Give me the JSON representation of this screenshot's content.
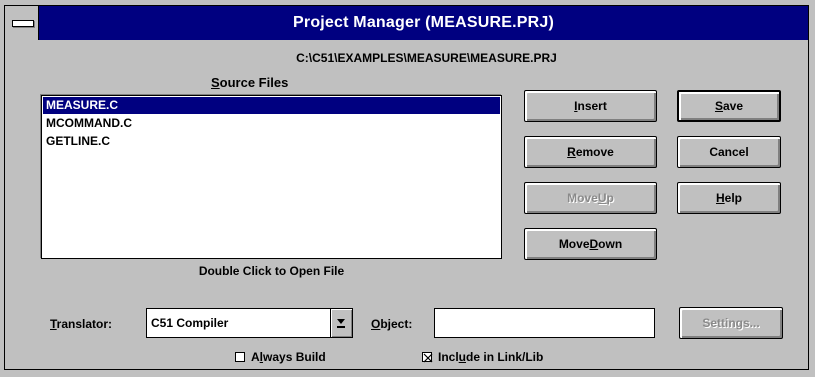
{
  "window": {
    "title": "Project Manager (MEASURE.PRJ)",
    "project_path": "C:\\C51\\EXAMPLES\\MEASURE\\MEASURE.PRJ"
  },
  "source_files": {
    "label_accel": "S",
    "label_rest": "ource Files",
    "items": [
      {
        "name": "MEASURE.C",
        "selected": true
      },
      {
        "name": "MCOMMAND.C",
        "selected": false
      },
      {
        "name": "GETLINE.C",
        "selected": false
      }
    ],
    "hint": "Double Click to Open File"
  },
  "buttons": {
    "insert": {
      "accel": "I",
      "rest": "nsert"
    },
    "remove": {
      "accel": "R",
      "rest": "emove"
    },
    "move_up": {
      "pre": "Move ",
      "accel": "U",
      "rest": "p",
      "disabled": true
    },
    "move_down": {
      "pre": "Move ",
      "accel": "D",
      "rest": "own"
    },
    "save": {
      "accel": "S",
      "rest": "ave"
    },
    "cancel": {
      "label": "Cancel"
    },
    "help": {
      "accel": "H",
      "rest": "elp"
    },
    "settings": {
      "label": "Settings...",
      "disabled": true
    }
  },
  "translator": {
    "label_accel": "T",
    "label_rest": "ranslator:",
    "value": "C51 Compiler"
  },
  "object": {
    "label_accel": "O",
    "label_rest": "bject:",
    "value": ""
  },
  "options": {
    "always_build": {
      "pre": "A",
      "accel": "l",
      "rest": "ways Build",
      "checked": false
    },
    "include": {
      "pre": "Incl",
      "accel": "u",
      "rest": "de in Link/Lib",
      "checked": true
    }
  },
  "colors": {
    "titlebar": "#000080",
    "selection": "#000080",
    "face": "#c0c0c0"
  }
}
